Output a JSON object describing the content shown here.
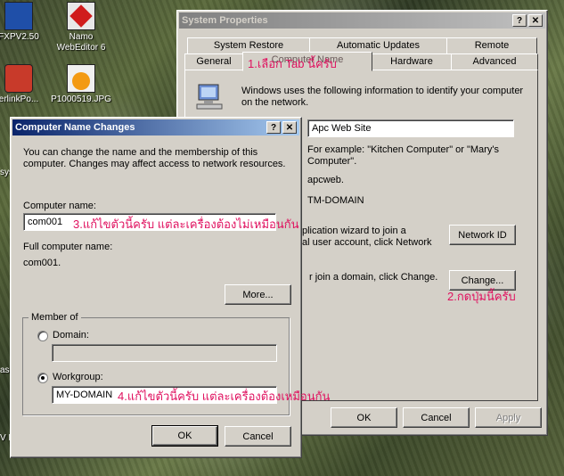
{
  "desktop": {
    "icons": [
      {
        "label": "FXPV2.50",
        "icon": "app-icon"
      },
      {
        "label": "Namo WebEditor 6",
        "icon": "namo-icon"
      },
      {
        "label": "erlinkPo...",
        "icon": "app-icon"
      },
      {
        "label": "P1000519.JPG",
        "icon": "jpg-file-icon"
      }
    ],
    "edge_labels": [
      "sys",
      "as",
      "V P"
    ]
  },
  "system_properties": {
    "title": "System Properties",
    "tabs_back": [
      "System Restore",
      "Automatic Updates",
      "Remote"
    ],
    "tabs_front": [
      "General",
      "Computer Name",
      "Hardware",
      "Advanced"
    ],
    "intro": "Windows uses the following information to identify your computer on the network.",
    "description_value": "Apc Web Site",
    "example": "For example: \"Kitchen Computer\" or \"Mary's Computer\".",
    "full_name": "apcweb.",
    "workgroup": "TM-DOMAIN",
    "network_id_text": "plication wizard to join a\nal user account, click Network",
    "network_id_label": "Network ID",
    "change_text": "r join a domain, click Change.",
    "change_label": "Change...",
    "ok": "OK",
    "cancel": "Cancel",
    "apply": "Apply"
  },
  "name_changes": {
    "title": "Computer Name Changes",
    "intro": "You can change the name and the membership of this computer. Changes may affect access to network resources.",
    "computer_name_label": "Computer name:",
    "computer_name_value": "com001",
    "full_name_label": "Full computer name:",
    "full_name_value": "com001.",
    "more_label": "More...",
    "member_of_label": "Member of",
    "domain_label": "Domain:",
    "domain_value": "",
    "workgroup_label": "Workgroup:",
    "workgroup_value": "MY-DOMAIN",
    "ok": "OK",
    "cancel": "Cancel"
  },
  "annotations": {
    "a1": "1.เลือก Tab นี้ครับ",
    "a2": "2.กดปุ่มนี้ครับ",
    "a3": "3.แก้ไขตัวนี้ครับ  แต่ละเครื่องต้องไม่เหมือนกัน",
    "a4": "4.แก้ไขตัวนี้ครับ  แต่ละเครื่องต้องเหมือนกัน"
  },
  "colors": {
    "annotation": "#e0115f",
    "active_title": "#0a246a",
    "inactive_title": "#808080"
  }
}
